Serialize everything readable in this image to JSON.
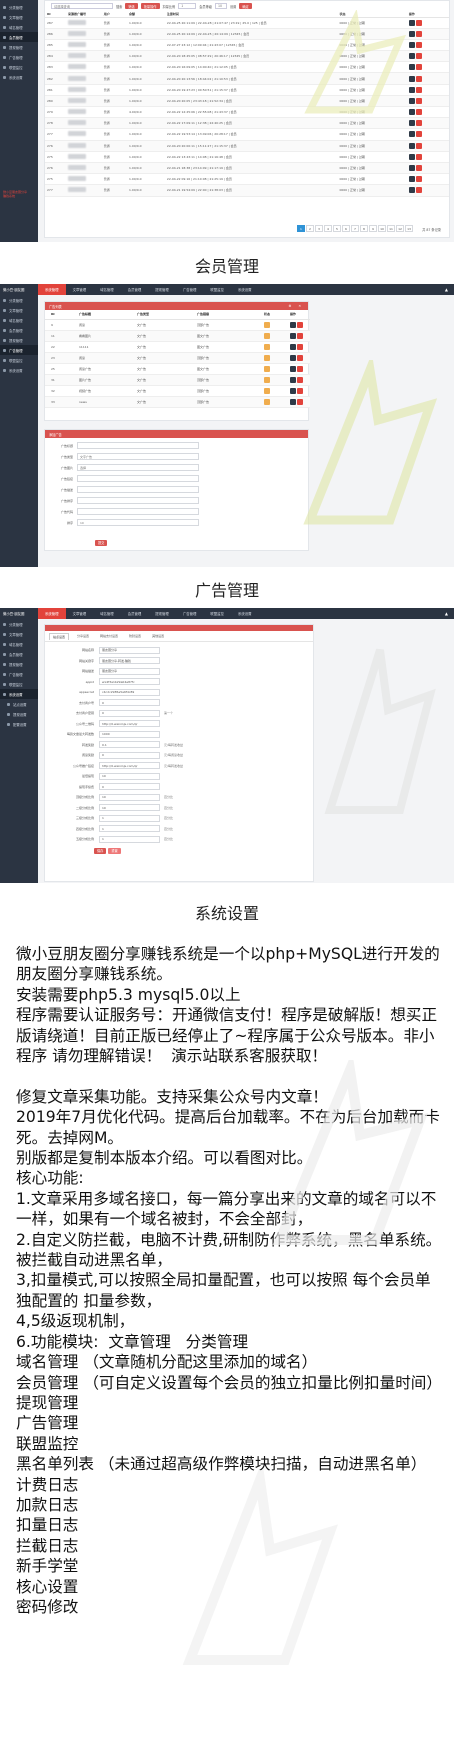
{
  "members": {
    "sidebar": {
      "items": [
        "分类管理",
        "文章管理",
        "域名管理",
        "会员管理",
        "提现管理",
        "广告管理",
        "联盟监控",
        "系统设置"
      ],
      "note": [
        "微小豆朋友圈分享",
        "赚钱系统"
      ]
    },
    "toolbar": {
      "search_placeholder": "请选择查询",
      "search_label": "搜索",
      "filter_label": "筛选",
      "manage_label": "批量操作",
      "rate_label": "扣量比例",
      "rate_value": "1",
      "level_label": "会员等级",
      "level_value": "10",
      "set_label": "设置",
      "set_button": "确定"
    },
    "columns": [
      "ID",
      "来源推广编号",
      "用户",
      "余额",
      "可用金额",
      "总收入",
      "手机号码",
      "注册时间",
      "上次登录",
      "状态",
      "操作"
    ],
    "rows": [
      {
        "id": "287",
        "role": "普通",
        "balance": "1.00/0.0",
        "times": "22-04-25 20:11:09 | 22-04-28 | 21:07:47 | 23:19 | 25.0 | 125 | 会员",
        "status": "0000 | 正常 | 过期"
      },
      {
        "id": "286",
        "role": "普通",
        "balance": "1.00/0.0",
        "times": "22-04-25 20:14:09 | 22-04-25 | 20:14:09 | 12345 | 会员",
        "status": "0000 | 正常 | 过期"
      },
      {
        "id": "285",
        "role": "普通",
        "balance": "1.00/0.0",
        "times": "22-07-27 23:12 | 12:09:04 | 21:43:07 | 12345 | 会员",
        "status": "0000 | 正常 | 过期"
      },
      {
        "id": "284",
        "role": "普通",
        "balance": "1.00/0.0",
        "times": "22-04-20 18:45:05 | 08:57:29 | 20:46:17 | 12345 | 会员",
        "status": "0000 | 正常 | 过期"
      },
      {
        "id": "283",
        "role": "普通",
        "balance": "1.00/0.0",
        "times": "22-04-20 16:09:05 | 14:00:40 | 21:12:05 | 会员",
        "status": "0000 | 正常 | 过期"
      },
      {
        "id": "282",
        "role": "普通",
        "balance": "1.00/0.0",
        "times": "22-04-20 20:13:56 | 18:44:02 | 21:10:53 | 会员",
        "status": "0000 | 正常 | 过期"
      },
      {
        "id": "281",
        "role": "普通",
        "balance": "1.00/0.0",
        "times": "22-04-20 19:47:23 | 00:50:51 | 21:15:37 | 会员",
        "status": "0000 | 正常 | 过期"
      },
      {
        "id": "280",
        "role": "普通",
        "balance": "1.00/0.0",
        "times": "22-04-20 20:05 | 23:43:18 | 21:52:34 | 会员",
        "status": "0000 | 正常 | 过期"
      },
      {
        "id": "279",
        "role": "普通",
        "balance": "4.00/0.0",
        "times": "22-04-22 12:25:06 | 22:55:08 | 21:43:37 | 会员",
        "status": "0000 | 正常 | 过期"
      },
      {
        "id": "278",
        "role": "普通",
        "balance": "1.00/0.0",
        "times": "22-04-22 17:09:11 | 12:38 | 22:40:25 | 会员",
        "status": "0000 | 正常 | 过期"
      },
      {
        "id": "277",
        "role": "普通",
        "balance": "1.00/0.0",
        "times": "22-04-22 19:53:14 | 13:49:06 | 20:28:17 | 会员",
        "status": "0000 | 正常 | 过期"
      },
      {
        "id": "276",
        "role": "普通",
        "balance": "1.00/0.0",
        "times": "22-04-20 20:00:11 | 15:11:27 | 21:15:37 | 会员",
        "status": "0000 | 正常 | 过期"
      },
      {
        "id": "275",
        "role": "普通",
        "balance": "1.00/0.0",
        "times": "22-04-22 13:43:11 | 14:08 | 21:16:48 | 会员",
        "status": "0000 | 正常 | 过期"
      },
      {
        "id": "276",
        "role": "普通",
        "balance": "1.00/0.0",
        "times": "22-04-21 18:38 | 23:14:09 | 21:17:19 | 会员",
        "status": "0000 | 正常 | 过期"
      },
      {
        "id": "275",
        "role": "普通",
        "balance": "1.00/0.0",
        "times": "22-04-22 09:16 | 21:10:08 | 21:25:19 | 会员",
        "status": "0000 | 正常 | 过期"
      },
      {
        "id": "277",
        "role": "普通",
        "balance": "1.00/0.0",
        "times": "22-04-21 19:54:09 | 22:00 | 21:38:03 | 会员",
        "status": "0000 | 正常 | 过期"
      }
    ],
    "pager": {
      "pages": [
        "1",
        "2",
        "3",
        "4",
        "5",
        "6",
        "7",
        "8",
        "9",
        "10",
        "11",
        "12",
        "13"
      ],
      "total": "共 87 条记录"
    }
  },
  "captions": {
    "members": "会员管理",
    "ads": "广告管理",
    "settings": "系统设置"
  },
  "ads": {
    "brand": "微小豆·朋友圈",
    "tabs": [
      "系统管理",
      "文章管理",
      "域名管理",
      "会员管理",
      "提现管理",
      "广告管理",
      "联盟监控",
      "系统设置"
    ],
    "list_title": "广告列表",
    "columns": [
      "ID",
      "广告标题",
      "广告类型",
      "广告链接",
      "状态",
      "操作"
    ],
    "rows": [
      {
        "id": "9",
        "title": "阅读",
        "type": "文广告",
        "link": "顶部广告"
      },
      {
        "id": "11",
        "title": "看看图片",
        "type": "文广告",
        "link": "图文广告"
      },
      {
        "id": "22",
        "title": "11111",
        "type": "文广告",
        "link": "图文广告"
      },
      {
        "id": "23",
        "title": "阅读",
        "type": "文广告",
        "link": "顶部广告"
      },
      {
        "id": "25",
        "title": "阅读广告",
        "type": "文广告",
        "link": "图文广告"
      },
      {
        "id": "31",
        "title": "图片广告",
        "type": "文广告",
        "link": "顶部广告"
      },
      {
        "id": "32",
        "title": "视频广告",
        "type": "文广告",
        "link": "顶部广告"
      },
      {
        "id": "33",
        "title": "news",
        "type": "文广告",
        "link": "顶部广告"
      }
    ],
    "form_title": "添加广告",
    "form_fields": [
      {
        "label": "广告标题",
        "value": ""
      },
      {
        "label": "广告类型",
        "value": "文字广告"
      },
      {
        "label": "广告图片",
        "value": "选择"
      },
      {
        "label": "广告链接",
        "value": ""
      },
      {
        "label": "广告描述",
        "value": ""
      },
      {
        "label": "广告排序",
        "value": ""
      },
      {
        "label": "广告代码",
        "value": ""
      },
      {
        "label": "排序",
        "value": "10"
      }
    ],
    "submit": "提交"
  },
  "settings": {
    "tabs": [
      "站点设置",
      "分享设置",
      "网站支付设置",
      "防封设置",
      "其他设置"
    ],
    "side_items": [
      "站点设置",
      "提现设置",
      "配置设置"
    ],
    "fields": [
      {
        "label": "网站名称",
        "value": "朋友圈分享",
        "hint": ""
      },
      {
        "label": "网站关键字",
        "value": "朋友圈分享,转发,赚钱",
        "hint": ""
      },
      {
        "label": "网站描述",
        "value": "朋友圈分享",
        "hint": ""
      },
      {
        "label": "appid",
        "value": "wx4f3a1b29a04e87fc",
        "hint": ""
      },
      {
        "label": "appsecret",
        "value": "c4c2c2985e5a6f4c89",
        "hint": ""
      },
      {
        "label": "支付商户号",
        "value": "0",
        "hint": ""
      },
      {
        "label": "支付商户密钥",
        "value": "0",
        "hint": "第一个"
      },
      {
        "label": "公众号二维码",
        "value": "http://0.weixinjs.com/qr",
        "hint": ""
      },
      {
        "label": "每篇文章最大转发数",
        "value": "1000",
        "hint": ""
      },
      {
        "label": "转发奖励",
        "value": "0.1",
        "hint": "元/每转发收益"
      },
      {
        "label": "阅读奖励",
        "value": "0",
        "hint": "元/每阅读收益"
      },
      {
        "label": "公众号推广链接",
        "value": "http://0.weixinjs.com/qr",
        "hint": "元/每转发收益"
      },
      {
        "label": "最低提现",
        "value": "10",
        "hint": ""
      },
      {
        "label": "提现手续费",
        "value": "0",
        "hint": ""
      },
      {
        "label": "顶级分成比例",
        "value": "10",
        "hint": "百分比"
      },
      {
        "label": "二级分成比例",
        "value": "10",
        "hint": "百分比"
      },
      {
        "label": "三级分成比例",
        "value": "1",
        "hint": "百分比"
      },
      {
        "label": "四级分成比例",
        "value": "1",
        "hint": "百分比"
      },
      {
        "label": "五级分成比例",
        "value": "1",
        "hint": "百分比"
      }
    ],
    "save": "保存",
    "reset": "重置"
  },
  "description": {
    "intro": [
      "微小豆朋友圈分享赚钱系统是一个以php+MySQL进行开发的朋友圈分享赚钱系统。",
      "安装需要php5.3 mysql5.0以上",
      "程序需要认证服务号：开通微信支付！程序是破解版！想买正版请绕道！目前正版已经停止了~程序属于公众号版本。非小程序 请勿理解错误！  演示站联系客服获取！"
    ],
    "body": [
      "修复文章采集功能。支持采集公众号内文章！",
      "2019年7月优化代码。提高后台加载率。不在为后台加载而卡死。去掉网M。",
      "别版都是复制本版本介绍。可以看图对比。",
      "核心功能:",
      "1.文章采用多域名接口，每一篇分享出来的文章的域名可以不一样，如果有一个域名被封，不会全部封，",
      "2.自定义防拦截，电脑不计费,研制防作弊系统，黑名单系统。被拦截自动进黑名单，",
      "3,扣量模式,可以按照全局扣量配置，也可以按照 每个会员单独配置的 扣量参数，",
      "4,5级返现机制，",
      "6.功能模块:  文章管理   分类管理",
      "域名管理 （文章随机分配这里添加的域名）",
      "会员管理 （可自定义设置每个会员的独立扣量比例扣量时间）",
      "提现管理",
      "广告管理",
      "联盟监控",
      "黑名单列表 （未通过超高级作弊模块扫描，自动进黑名单）",
      "计费日志",
      "加款日志",
      "扣量日志",
      "拦截日志",
      "新手学堂",
      "核心设置",
      "密码修改"
    ]
  }
}
